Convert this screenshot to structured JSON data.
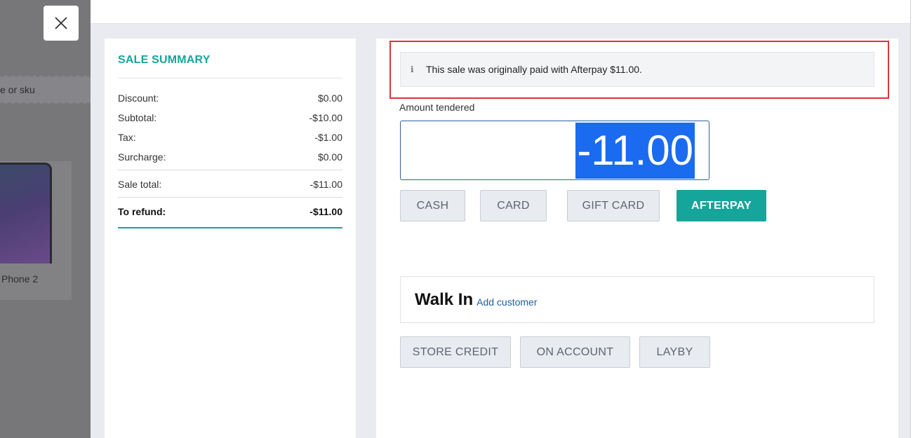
{
  "background": {
    "search_placeholder_fragment": "e or sku",
    "product_label_fragment": "Phone 2"
  },
  "close_icon": "close-icon",
  "summary": {
    "title": "SALE SUMMARY",
    "rows": [
      {
        "label": "Discount:",
        "value": "$0.00"
      },
      {
        "label": "Subtotal:",
        "value": "-$10.00"
      },
      {
        "label": "Tax:",
        "value": "-$1.00"
      },
      {
        "label": "Surcharge:",
        "value": "$0.00"
      }
    ],
    "sale_total": {
      "label": "Sale total:",
      "value": "-$11.00"
    },
    "to_refund": {
      "label": "To refund:",
      "value": "-$11.00"
    }
  },
  "payment": {
    "info_icon_glyph": "ℹ",
    "info_text": "This sale was originally paid with Afterpay $11.00.",
    "amount_label": "Amount tendered",
    "amount_value": "-11.00",
    "methods": [
      "CASH",
      "CARD",
      "GIFT CARD",
      "AFTERPAY"
    ],
    "customer_name": "Walk In",
    "add_customer_label": "Add customer",
    "account_methods": [
      "STORE CREDIT",
      "ON ACCOUNT",
      "LAYBY"
    ]
  },
  "colors": {
    "accent": "#16a59a",
    "highlight_border": "#d9343a",
    "selection": "#1a6bf0"
  }
}
